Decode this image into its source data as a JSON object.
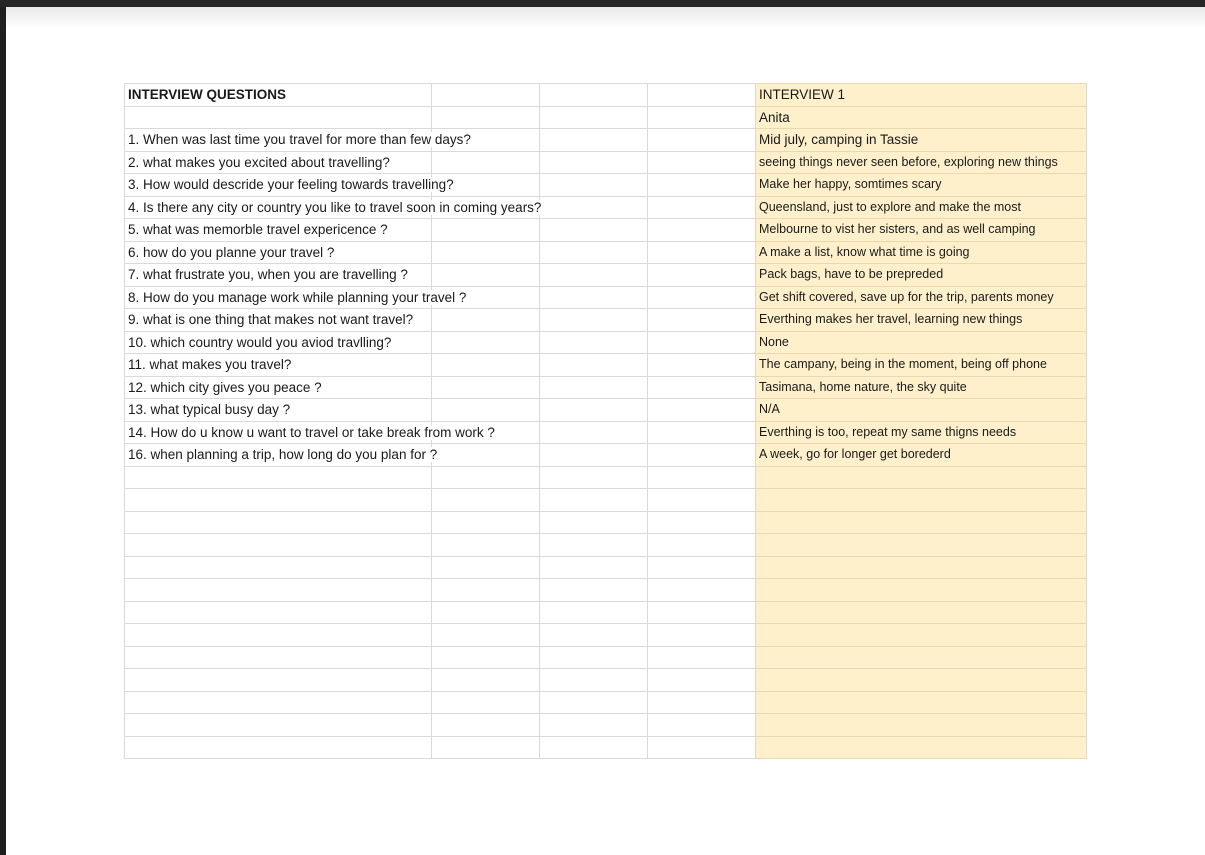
{
  "sheet": {
    "header_left": "INTERVIEW QUESTIONS",
    "header_right": "INTERVIEW 1",
    "interviewee": "Anita",
    "rows": [
      {
        "question": " 1. When was last time you travel for more than few days?",
        "answer": "Mid july, camping in Tassie"
      },
      {
        "question": " 2. what makes you excited about travelling?",
        "answer": "seeing things never seen before, exploring new things"
      },
      {
        "question": "3.  How would descride your feeling towards travelling?",
        "answer": " Make her happy, somtimes scary"
      },
      {
        "question": " 4. Is there any city or country you like to travel soon in coming years?",
        "answer": "Queensland, just to explore and make the most"
      },
      {
        "question": " 5. what was memorble travel expericence ?",
        "answer": "Melbourne to vist her sisters, and as well camping"
      },
      {
        "question": "6.  how do you planne your travel ?",
        "answer": "A make a list, know what time is going"
      },
      {
        "question": " 7. what frustrate you, when you are travelling ?",
        "answer": "Pack bags, have to be prepreded"
      },
      {
        "question": "8. How do you manage work while planning your travel ?",
        "answer": "Get shift covered, save up for the trip, parents money"
      },
      {
        "question": "9. what is one thing that makes not want travel?",
        "answer": "Everthing makes her travel, learning new things"
      },
      {
        "question": "10. which country would you aviod travlling?",
        "answer": "None"
      },
      {
        "question": "11. what makes you travel?",
        "answer": "The campany, being in the moment, being off phone"
      },
      {
        "question": "12. which city gives you peace ?",
        "answer": "Tasimana, home nature, the sky quite"
      },
      {
        "question": " 13. what typical busy day ?",
        "answer": "N/A"
      },
      {
        "question": "14. How do u know u want to travel or take break from work ?",
        "answer": "Everthing is too, repeat my same thigns needs"
      },
      {
        "question": " 16. when planning a trip, how long do you plan for ?",
        "answer": "A week, go for longer get borederd"
      }
    ]
  },
  "colors": {
    "answer_column_bg": "#fff0cc",
    "grid_line": "#d9d9d9"
  }
}
